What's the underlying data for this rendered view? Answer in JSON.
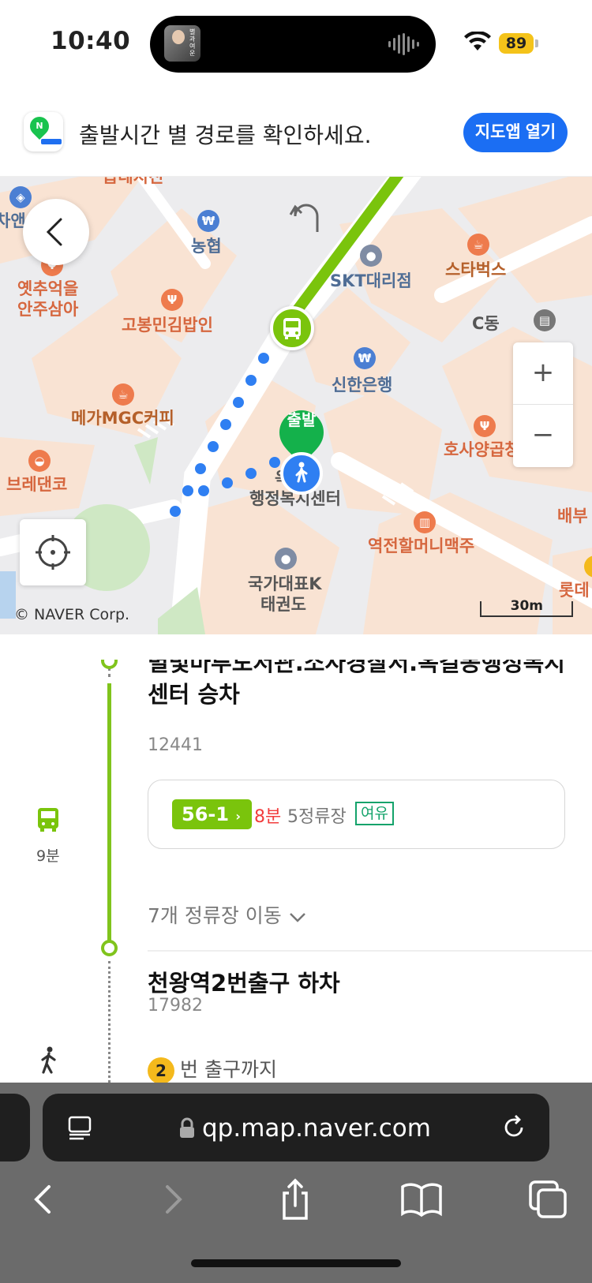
{
  "status_bar": {
    "time": "10:40",
    "battery": "89",
    "album_text": "별과여운"
  },
  "banner": {
    "text": "출발시간 별 경로를 확인하세요.",
    "open_button": "지도앱 열기",
    "logo_letter": "N"
  },
  "map": {
    "labels": {
      "top_left_partial": "곱데지진",
      "far_left": "차앤",
      "nonghyup": "농협",
      "yeot": "옛추억을",
      "yeot2": "안주삼아",
      "gobong": "고봉민김밥인",
      "mega": "메가MGC커피",
      "breadcode": "브레댄코",
      "skt": "SKT대리점",
      "starbucks": "스타벅스",
      "cdong": "C동",
      "shinhan": "신한은행",
      "hosa": "호사양곱창",
      "baebu": "배부",
      "okgil": "옥길동",
      "center": "행정복지센터",
      "yeokjeon": "역전할머니맥주",
      "gukga": "국가대표K",
      "taekwondo": "태권도",
      "lotte": "롯데"
    },
    "start_label": "출발",
    "copyright": "© NAVER Corp.",
    "scale": "30m",
    "zoom_in": "+",
    "zoom_out": "−"
  },
  "route": {
    "board_stop": "별빛마루도서관.소사경찰서.옥길동행정복지",
    "board_stop_line2": "센터 승차",
    "board_stop_id": "12441",
    "bus_number": "56-1",
    "eta": "8분",
    "stops_left": "5정류장",
    "crowd": "여유",
    "ride_time": "9분",
    "expand_label": "7개 정류장 이동",
    "alight_stop": "천왕역2번출구 하차",
    "alight_stop_id": "17982",
    "exit_number": "2",
    "exit_text": "번 출구까지"
  },
  "browser": {
    "url": "qp.map.naver.com"
  },
  "colors": {
    "bus_green": "#7ac40c",
    "walk_blue": "#2f7ff2",
    "banner_button": "#1b6ef3",
    "eta_red": "#f23c3c",
    "crowd_green": "#14a36b"
  }
}
